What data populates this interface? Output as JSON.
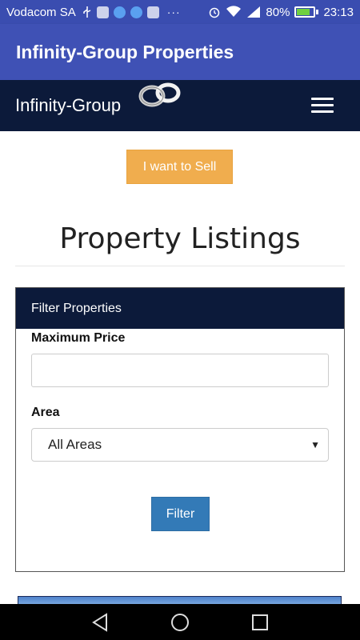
{
  "status_bar": {
    "carrier": "Vodacom SA",
    "battery": "80%",
    "battery_level": 0.8,
    "time": "23:13",
    "more": "···"
  },
  "app_bar": {
    "title": "Infinity-Group Properties"
  },
  "site_nav": {
    "brand": "Infinity-Group",
    "logo_icon": "infinity-logo"
  },
  "actions": {
    "sell_label": "I want to Sell"
  },
  "main": {
    "title": "Property Listings"
  },
  "filter_panel": {
    "heading": "Filter Properties",
    "max_price_label": "Maximum Price",
    "max_price_value": "",
    "area_label": "Area",
    "area_selected": "All Areas",
    "filter_button": "Filter"
  },
  "colors": {
    "app_bar": "#3f51b5",
    "status_bar": "#3a4db0",
    "site_nav": "#0c1a3a",
    "sell_button": "#f0ad4e",
    "filter_button": "#337ab7"
  },
  "android_nav": {
    "icons": [
      "back-icon",
      "home-icon",
      "recents-icon"
    ]
  }
}
